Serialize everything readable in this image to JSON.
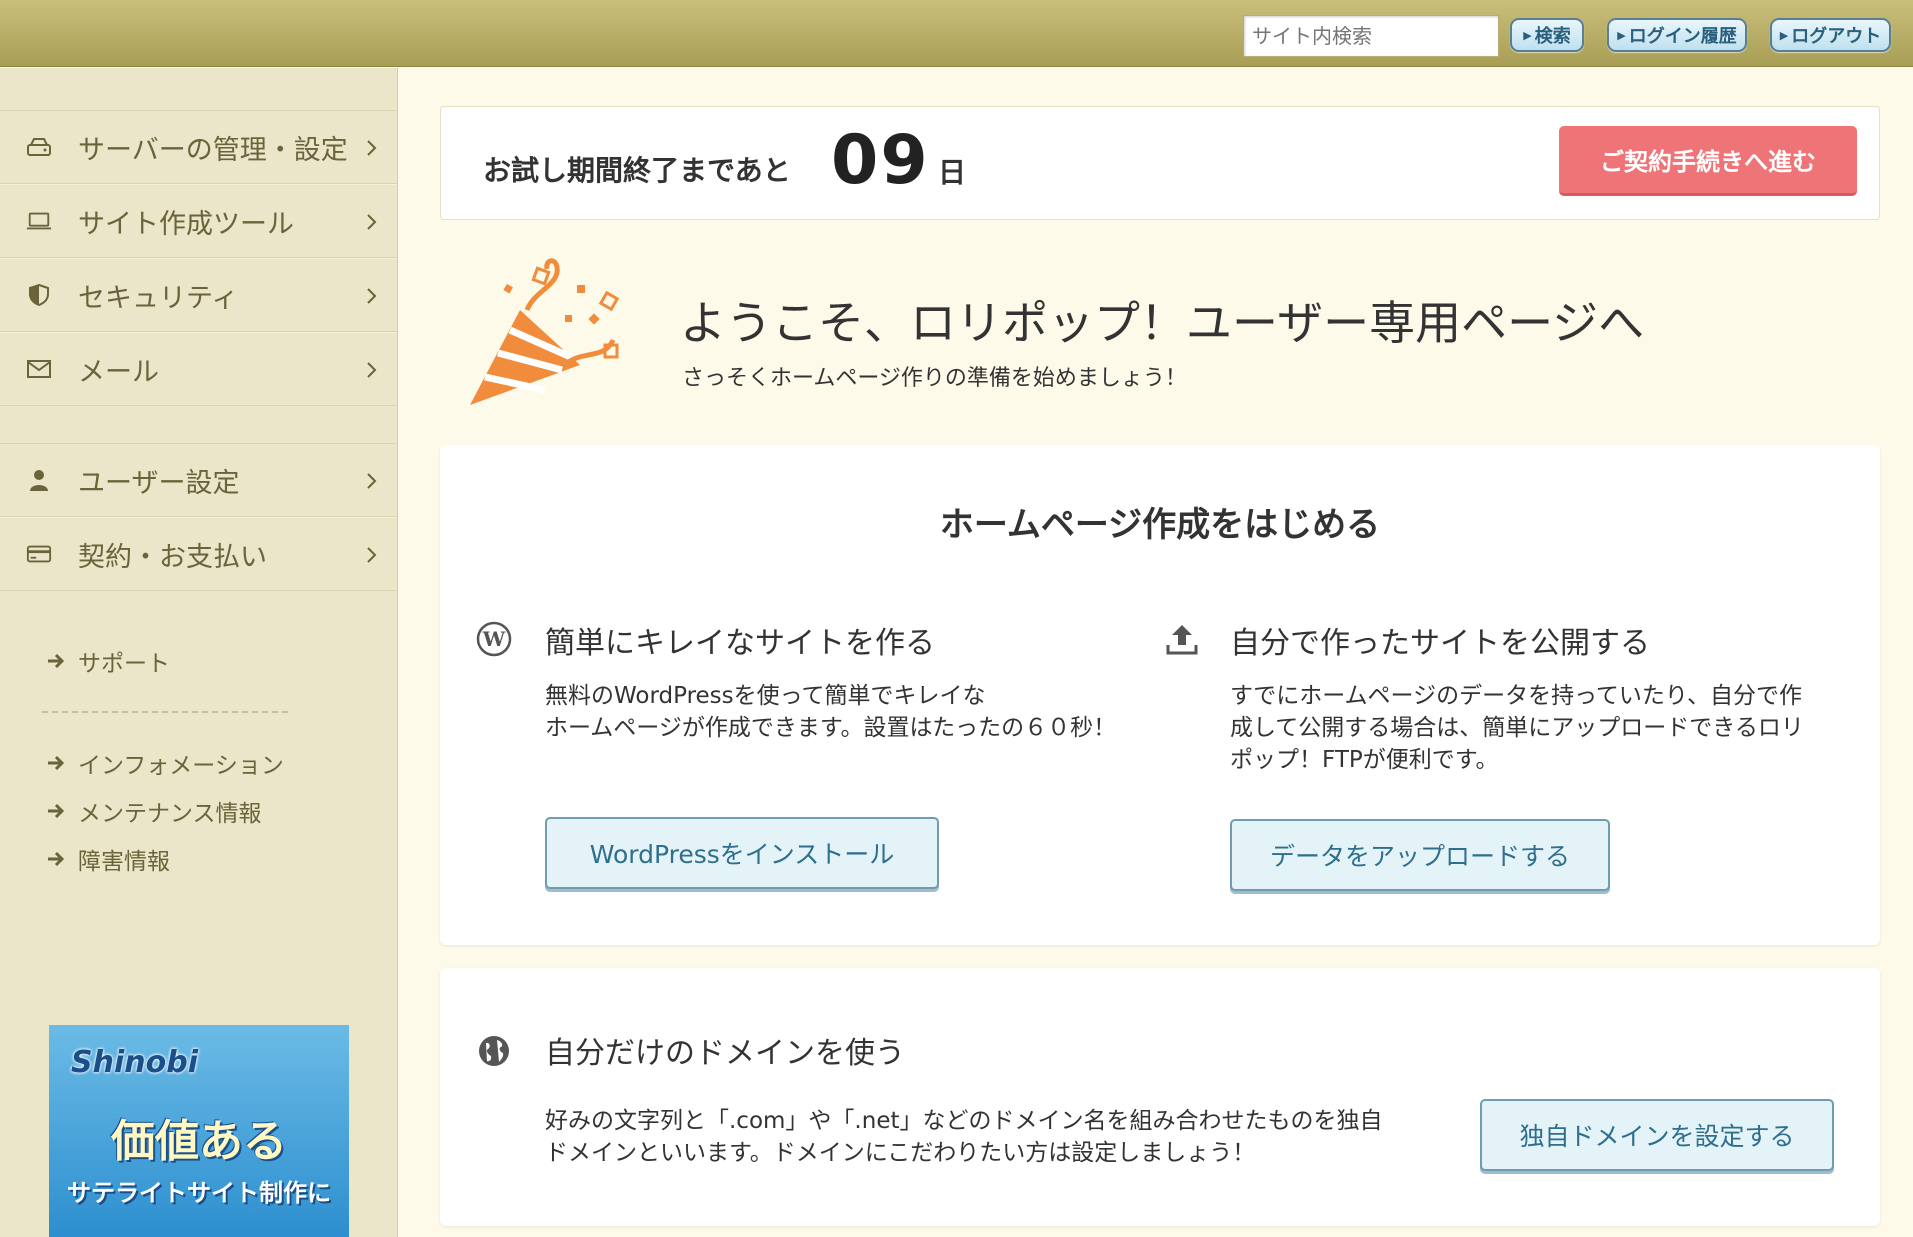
{
  "topbar": {
    "search_placeholder": "サイト内検索",
    "search_button": "検索",
    "login_history_button": "ログイン履歴",
    "logout_button": "ログアウト"
  },
  "sidebar": {
    "items": [
      {
        "label": "サーバーの管理・設定",
        "icon": "server-icon"
      },
      {
        "label": "サイト作成ツール",
        "icon": "laptop-icon"
      },
      {
        "label": "セキュリティ",
        "icon": "shield-icon"
      },
      {
        "label": "メール",
        "icon": "mail-icon"
      }
    ],
    "items2": [
      {
        "label": "ユーザー設定",
        "icon": "user-icon"
      },
      {
        "label": "契約・お支払い",
        "icon": "credit-card-icon"
      }
    ],
    "support": "サポート",
    "links": [
      "インフォメーション",
      "メンテナンス情報",
      "障害情報"
    ],
    "banner": {
      "logo": "Shinobi",
      "main": "価値ある",
      "sub": "サテライトサイト制作に"
    }
  },
  "trial": {
    "text": "お試し期間終了まであと",
    "days": "09",
    "unit": "日",
    "contract_button": "ご契約手続きへ進む"
  },
  "welcome": {
    "title": "ようこそ、ロリポップ！ユーザー専用ページへ",
    "subtitle": "さっそくホームページ作りの準備を始めましょう！"
  },
  "start_card": {
    "title": "ホームページ作成をはじめる",
    "col1": {
      "title": "簡単にキレイなサイトを作る",
      "desc_line1": "無料のWordPressを使って簡単でキレイな",
      "desc_line2": "ホームページが作成できます。設置はたったの６０秒！",
      "button": "WordPressをインストール"
    },
    "col2": {
      "title": "自分で作ったサイトを公開する",
      "desc_line1": "すでにホームページのデータを持っていたり、自分で作",
      "desc_line2": "成して公開する場合は、簡単にアップロードできるロリ",
      "desc_line3": "ポップ！FTPが便利です。",
      "button": "データをアップロードする"
    }
  },
  "domain_card": {
    "title": "自分だけのドメインを使う",
    "desc_line1": "好みの文字列と「.com」や「.net」などのドメイン名を組み合わせたものを独自",
    "desc_line2": "ドメインといいます。ドメインにこだわりたい方は設定しましょう！",
    "button": "独自ドメインを設定する"
  },
  "colors": {
    "topbar": "#b5ab63",
    "sidebar": "#ebe6c9",
    "accent_pink": "#ef7478",
    "accent_orange": "#f08c3c",
    "button_blue": "#2e6f8e"
  }
}
